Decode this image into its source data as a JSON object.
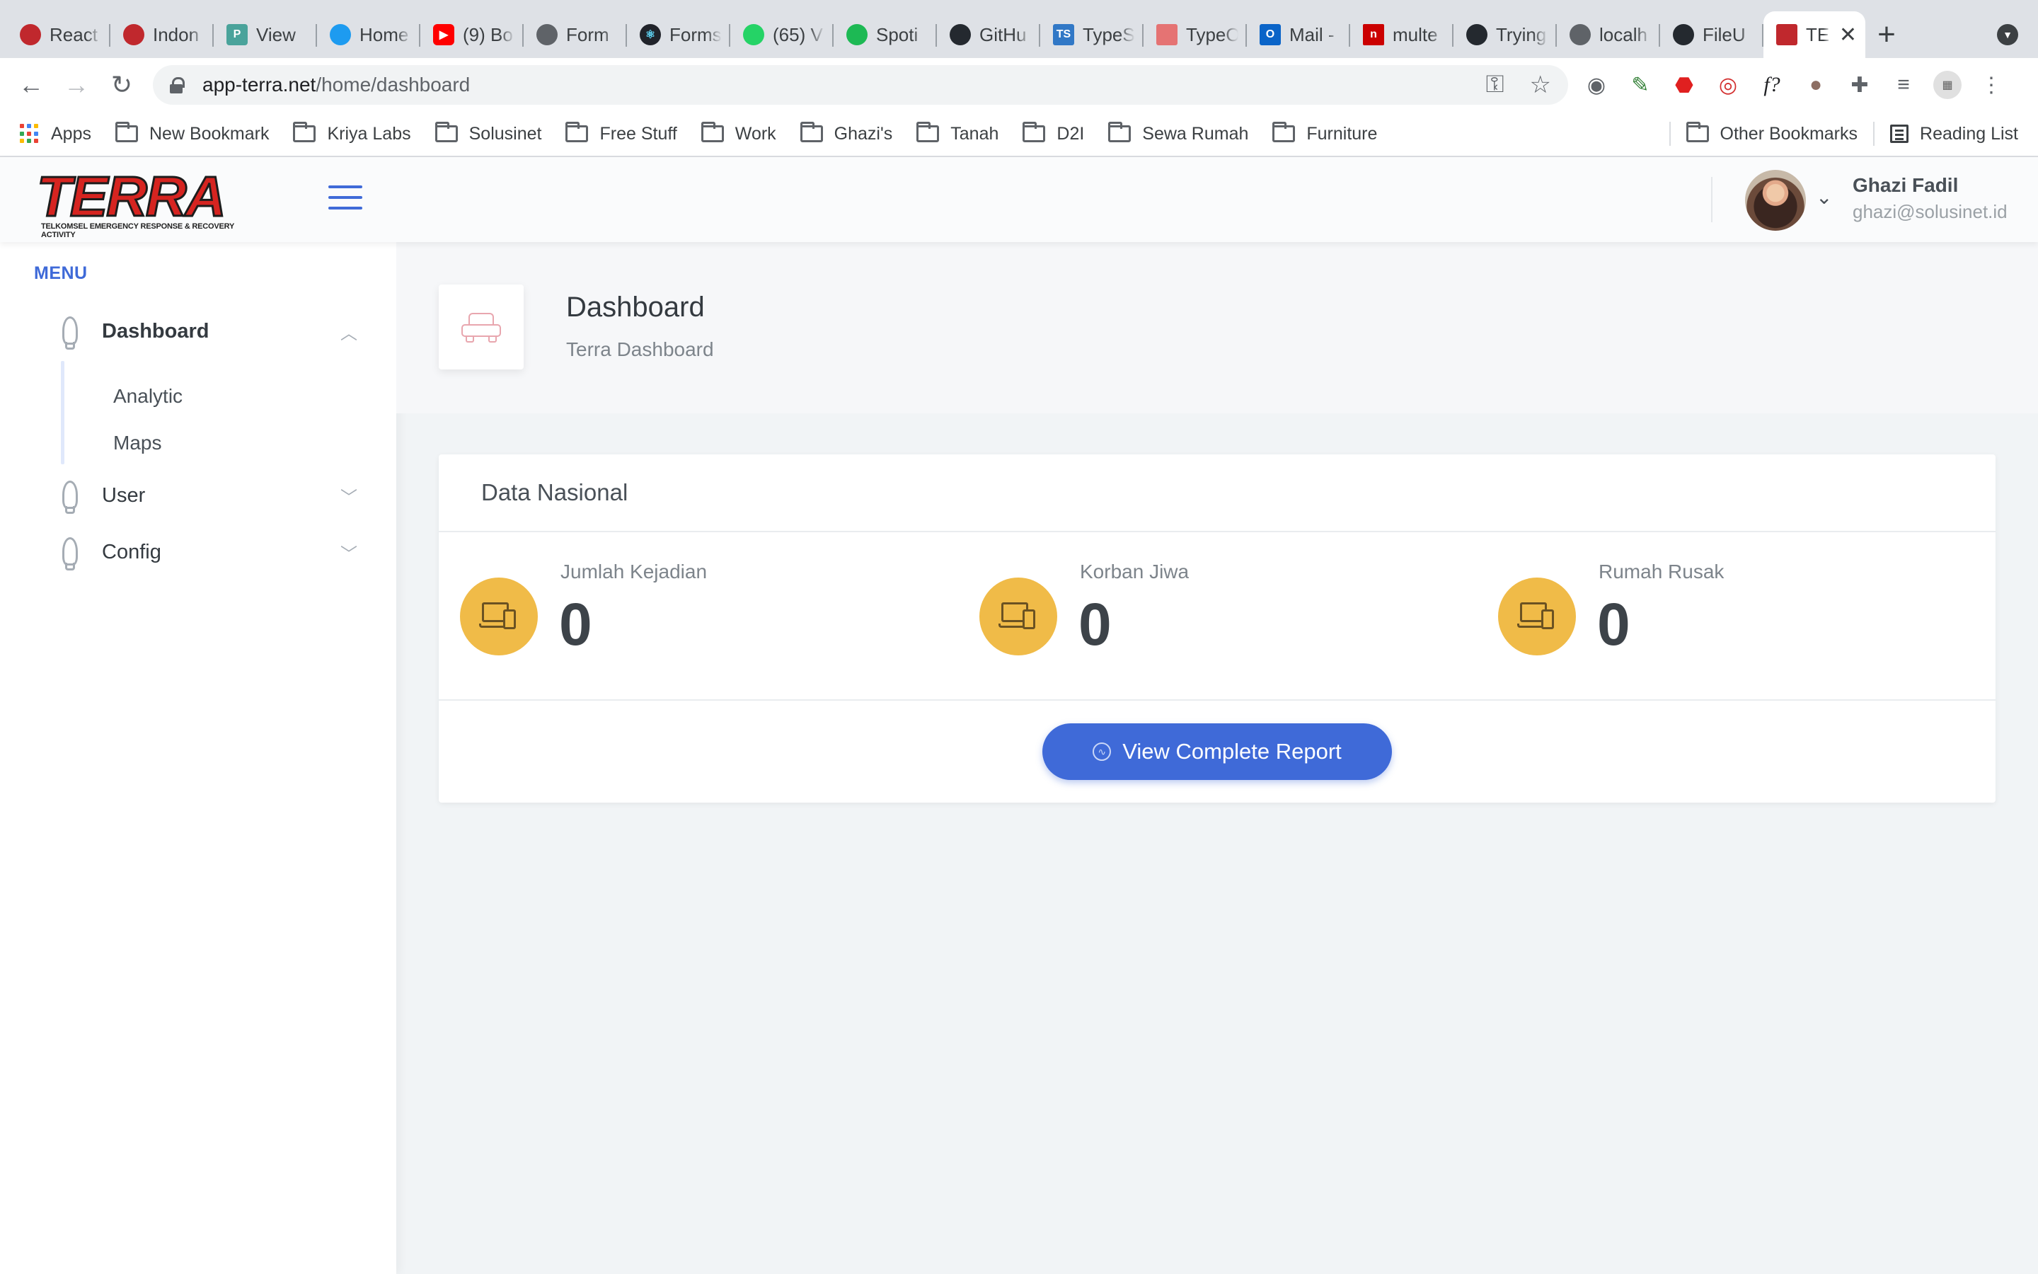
{
  "browser": {
    "tabs": [
      {
        "title": "React",
        "favicon": "react-ball-icon",
        "color": "#c0282d"
      },
      {
        "title": "Indon",
        "favicon": "react-ball-icon",
        "color": "#c0282d"
      },
      {
        "title": "View",
        "favicon": "p-icon",
        "color": "#4aa39b"
      },
      {
        "title": "Home",
        "favicon": "twitter-icon",
        "color": "#1d9bf0"
      },
      {
        "title": "(9) Bo",
        "favicon": "youtube-icon",
        "color": "#ff0000"
      },
      {
        "title": "Form",
        "favicon": "globe-icon",
        "color": "#5f6368"
      },
      {
        "title": "Forms",
        "favicon": "react-icon",
        "color": "#20232a"
      },
      {
        "title": "(65) V",
        "favicon": "whatsapp-icon",
        "color": "#25d366"
      },
      {
        "title": "Spoti",
        "favicon": "spotify-icon",
        "color": "#1db954"
      },
      {
        "title": "GitHu",
        "favicon": "github-icon",
        "color": "#24292f"
      },
      {
        "title": "TypeS",
        "favicon": "typescript-icon",
        "color": "#3178c6"
      },
      {
        "title": "TypeO",
        "favicon": "document-icon",
        "color": "#e57373"
      },
      {
        "title": "Mail -",
        "favicon": "outlook-icon",
        "color": "#0a64c8"
      },
      {
        "title": "multe",
        "favicon": "npm-icon",
        "color": "#cb0000"
      },
      {
        "title": "Trying",
        "favicon": "github-icon",
        "color": "#24292f"
      },
      {
        "title": "localh",
        "favicon": "globe-icon",
        "color": "#5f6368"
      },
      {
        "title": "FileU",
        "favicon": "github-icon",
        "color": "#24292f"
      }
    ],
    "active_tab": {
      "title": "TE",
      "favicon": "terra-icon",
      "color": "#c0282d"
    },
    "url_host": "app-terra.net",
    "url_path": "/home/dashboard",
    "bookmarks": [
      "Apps",
      "New Bookmark",
      "Kriya Labs",
      "Solusinet",
      "Free Stuff",
      "Work",
      "Ghazi's",
      "Tanah",
      "D2I",
      "Sewa Rumah",
      "Furniture"
    ],
    "other_bookmarks": "Other Bookmarks",
    "reading_list": "Reading List"
  },
  "app": {
    "logo_text": "TERRA",
    "logo_subtitle": "TELKOMSEL EMERGENCY RESPONSE & RECOVERY ACTIVITY",
    "user": {
      "name": "Ghazi Fadil",
      "email": "ghazi@solusinet.id"
    },
    "accent": "#3f6ad8"
  },
  "sidebar": {
    "heading": "MENU",
    "items": [
      {
        "label": "Dashboard",
        "expanded": true,
        "children": [
          "Analytic",
          "Maps"
        ]
      },
      {
        "label": "User",
        "expanded": false
      },
      {
        "label": "Config",
        "expanded": false
      }
    ]
  },
  "page": {
    "title": "Dashboard",
    "subtitle": "Terra Dashboard"
  },
  "card": {
    "title": "Data Nasional",
    "stats": [
      {
        "label": "Jumlah Kejadian",
        "value": "0"
      },
      {
        "label": "Korban Jiwa",
        "value": "0"
      },
      {
        "label": "Rumah Rusak",
        "value": "0"
      }
    ],
    "button_label": "View Complete Report",
    "stat_color": "#f0bb48"
  }
}
